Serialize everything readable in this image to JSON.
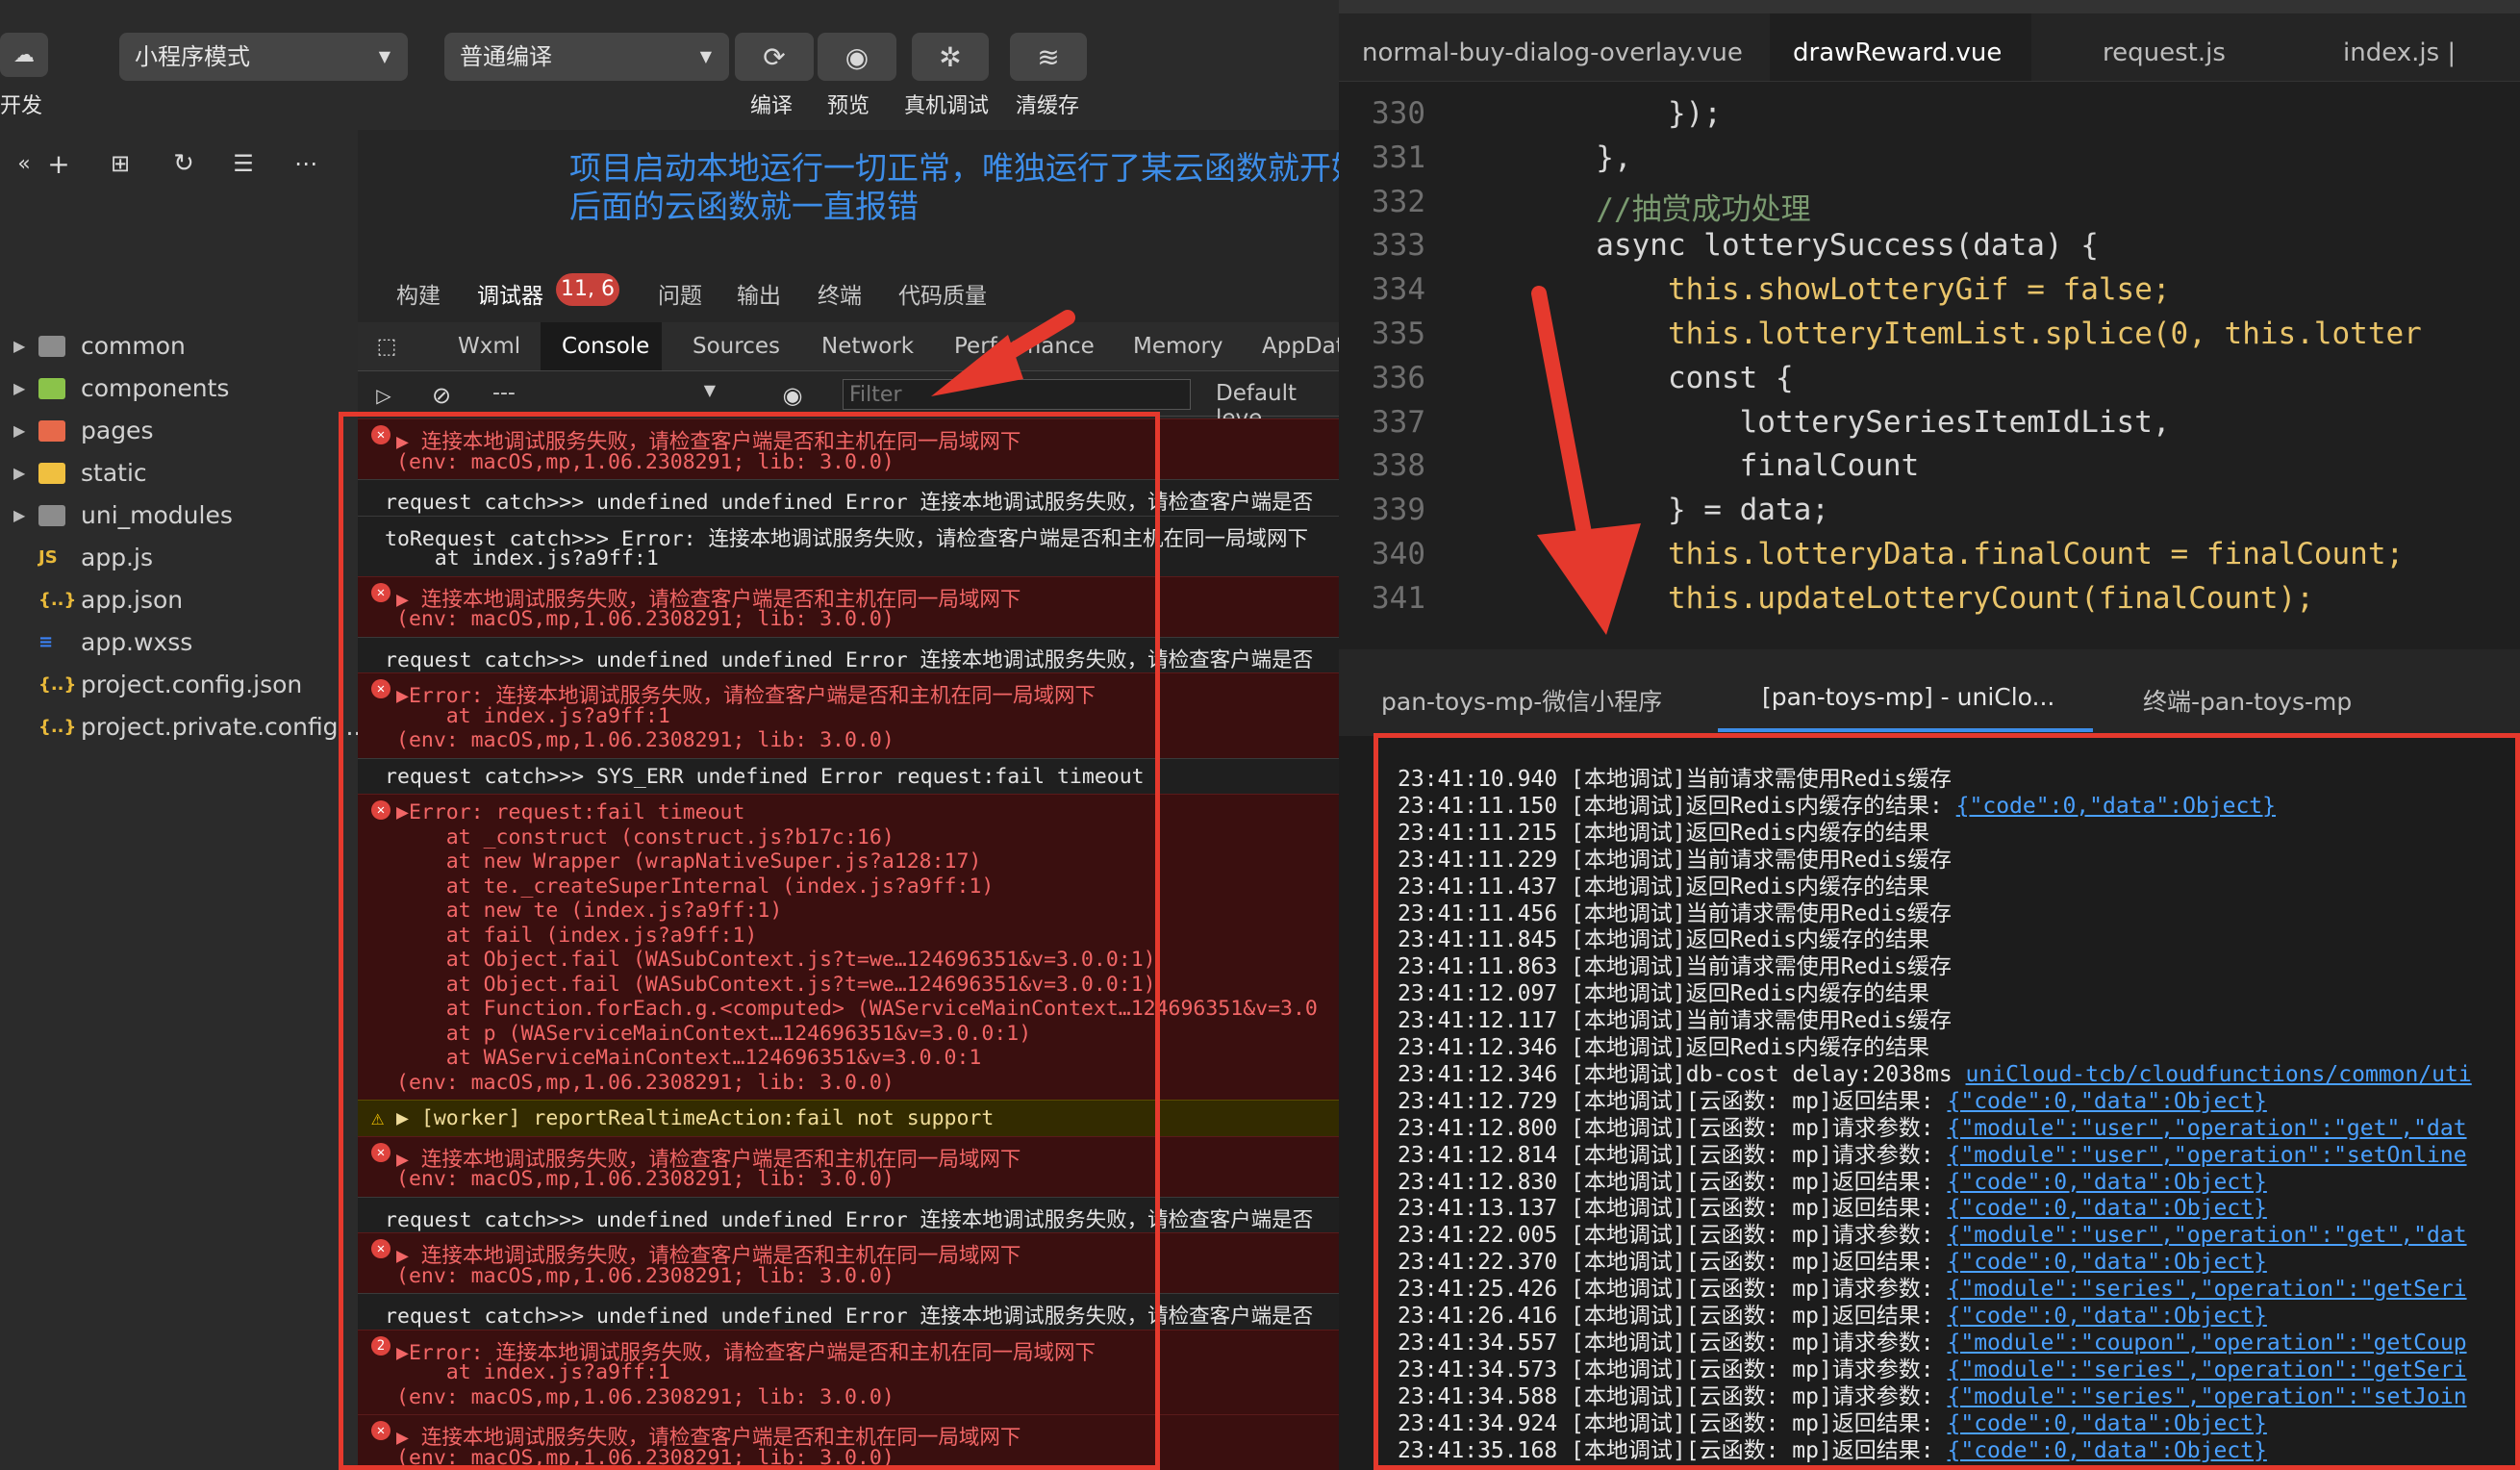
{
  "toolbar": {
    "left_label": "开发",
    "mode_select": "小程序模式",
    "compile_select": "普通编译",
    "compile_label": "编译",
    "preview_label": "预览",
    "debug_label": "真机调试",
    "clear_label": "清缓存"
  },
  "file_tree": [
    {
      "name": "common",
      "type": "folder",
      "color": "#8c8c8c"
    },
    {
      "name": "components",
      "type": "folder",
      "color": "#8bc34a"
    },
    {
      "name": "pages",
      "type": "folder",
      "color": "#e7694a"
    },
    {
      "name": "static",
      "type": "folder",
      "color": "#f0c040"
    },
    {
      "name": "uni_modules",
      "type": "folder",
      "color": "#8c8c8c"
    },
    {
      "name": "app.js",
      "type": "file",
      "badge": "JS",
      "color": "#e8b93a"
    },
    {
      "name": "app.json",
      "type": "file",
      "badge": "{..}",
      "color": "#e8b93a"
    },
    {
      "name": "app.wxss",
      "type": "file",
      "badge": "≡",
      "color": "#3b82f6"
    },
    {
      "name": "project.config.json",
      "type": "file",
      "badge": "{..}",
      "color": "#e8b93a"
    },
    {
      "name": "project.private.config...",
      "type": "file",
      "badge": "{..}",
      "color": "#e8b93a"
    }
  ],
  "annotation": {
    "line1": "项目启动本地运行一切正常，唯独运行了某云函数就开始报错了，",
    "line2": "后面的云函数就一直报错"
  },
  "devtools": {
    "top_tabs": [
      "构建",
      "调试器",
      "问题",
      "输出",
      "终端",
      "代码质量"
    ],
    "badge": "11, 6",
    "panel_tabs": [
      "Wxml",
      "Console",
      "Sources",
      "Network",
      "Performance",
      "Memory",
      "AppData"
    ],
    "context_select": "---",
    "filter_placeholder": "Filter",
    "levels": "Default leve"
  },
  "console": [
    {
      "kind": "err",
      "lines": [
        "▶ 连接本地调试服务失败，请检查客户端是否和主机在同一局域网下",
        "(env: macOS,mp,1.06.2308291; lib: 3.0.0)"
      ]
    },
    {
      "kind": "plain",
      "lines": [
        "request catch>>> undefined undefined Error 连接本地调试服务失败，请检查客户端是否"
      ]
    },
    {
      "kind": "plain",
      "lines": [
        "toRequest catch>>> Error: 连接本地调试服务失败，请检查客户端是否和主机在同一局域网下",
        "    at index.js?a9ff:1"
      ]
    },
    {
      "kind": "err",
      "lines": [
        "▶ 连接本地调试服务失败，请检查客户端是否和主机在同一局域网下",
        "(env: macOS,mp,1.06.2308291; lib: 3.0.0)"
      ]
    },
    {
      "kind": "plain",
      "lines": [
        "request catch>>> undefined undefined Error 连接本地调试服务失败，请检查客户端是否"
      ]
    },
    {
      "kind": "err",
      "lines": [
        "▶Error: 连接本地调试服务失败，请检查客户端是否和主机在同一局域网下",
        "    at index.js?a9ff:1",
        "(env: macOS,mp,1.06.2308291; lib: 3.0.0)"
      ]
    },
    {
      "kind": "plain",
      "lines": [
        "request catch>>> SYS_ERR undefined Error request:fail timeout"
      ]
    },
    {
      "kind": "err",
      "lines": [
        "▶Error: request:fail timeout",
        "    at _construct (construct.js?b17c:16)",
        "    at new Wrapper (wrapNativeSuper.js?a128:17)",
        "    at te._createSuperInternal (index.js?a9ff:1)",
        "    at new te (index.js?a9ff:1)",
        "    at fail (index.js?a9ff:1)",
        "    at Object.fail (WASubContext.js?t=we…124696351&v=3.0.0:1)",
        "    at Object.fail (WASubContext.js?t=we…124696351&v=3.0.0:1)",
        "    at Function.forEach.g.<computed> (WAServiceMainContext…124696351&v=3.0",
        "    at p (WAServiceMainContext…124696351&v=3.0.0:1)",
        "    at WAServiceMainContext…124696351&v=3.0.0:1",
        "(env: macOS,mp,1.06.2308291; lib: 3.0.0)"
      ]
    },
    {
      "kind": "warn",
      "lines": [
        "▶ [worker] reportRealtimeAction:fail not support"
      ]
    },
    {
      "kind": "err",
      "lines": [
        "▶ 连接本地调试服务失败，请检查客户端是否和主机在同一局域网下",
        "(env: macOS,mp,1.06.2308291; lib: 3.0.0)"
      ]
    },
    {
      "kind": "plain",
      "lines": [
        "request catch>>> undefined undefined Error 连接本地调试服务失败，请检查客户端是否"
      ]
    },
    {
      "kind": "err",
      "lines": [
        "▶ 连接本地调试服务失败，请检查客户端是否和主机在同一局域网下",
        "(env: macOS,mp,1.06.2308291; lib: 3.0.0)"
      ]
    },
    {
      "kind": "plain",
      "lines": [
        "request catch>>> undefined undefined Error 连接本地调试服务失败，请检查客户端是否"
      ]
    },
    {
      "kind": "err2",
      "count": "2",
      "lines": [
        "▶Error: 连接本地调试服务失败，请检查客户端是否和主机在同一局域网下",
        "    at index.js?a9ff:1",
        "(env: macOS,mp,1.06.2308291; lib: 3.0.0)"
      ]
    },
    {
      "kind": "err",
      "lines": [
        "▶ 连接本地调试服务失败，请检查客户端是否和主机在同一局域网下",
        "(env: macOS,mp,1.06.2308291; lib: 3.0.0)"
      ]
    }
  ],
  "editor": {
    "tabs": [
      "normal-buy-dialog-overlay.vue",
      "drawReward.vue",
      "request.js",
      "index.js | const"
    ],
    "active_tab": 1,
    "lines": [
      {
        "n": "330",
        "code": "            });"
      },
      {
        "n": "331",
        "code": "        },"
      },
      {
        "n": "332",
        "code": "        //抽赏成功处理"
      },
      {
        "n": "333",
        "code": "        async lotterySuccess(data) {"
      },
      {
        "n": "334",
        "code": "            this.showLotteryGif = false;"
      },
      {
        "n": "335",
        "code": "            this.lotteryItemList.splice(0, this.lotter"
      },
      {
        "n": "336",
        "code": "            const {"
      },
      {
        "n": "337",
        "code": "                lotterySeriesItemIdList,"
      },
      {
        "n": "338",
        "code": "                finalCount"
      },
      {
        "n": "339",
        "code": "            } = data;"
      },
      {
        "n": "340",
        "code": "            this.lotteryData.finalCount = finalCount;"
      },
      {
        "n": "341",
        "code": "            this.updateLotteryCount(finalCount);"
      }
    ]
  },
  "terminal": {
    "tabs": [
      "pan-toys-mp-微信小程序",
      "[pan-toys-mp] - uniClo...",
      "终端-pan-toys-mp"
    ],
    "lines": [
      {
        "t": "23:41:10.940",
        "msg": "[本地调试]当前请求需使用Redis缓存",
        "link": ""
      },
      {
        "t": "23:41:11.150",
        "msg": "[本地调试]返回Redis内缓存的结果:",
        "link": "{\"code\":0,\"data\":Object}"
      },
      {
        "t": "23:41:11.215",
        "msg": "[本地调试]返回Redis内缓存的结果",
        "link": ""
      },
      {
        "t": "23:41:11.229",
        "msg": "[本地调试]当前请求需使用Redis缓存",
        "link": ""
      },
      {
        "t": "23:41:11.437",
        "msg": "[本地调试]返回Redis内缓存的结果",
        "link": ""
      },
      {
        "t": "23:41:11.456",
        "msg": "[本地调试]当前请求需使用Redis缓存",
        "link": ""
      },
      {
        "t": "23:41:11.845",
        "msg": "[本地调试]返回Redis内缓存的结果",
        "link": ""
      },
      {
        "t": "23:41:11.863",
        "msg": "[本地调试]当前请求需使用Redis缓存",
        "link": ""
      },
      {
        "t": "23:41:12.097",
        "msg": "[本地调试]返回Redis内缓存的结果",
        "link": ""
      },
      {
        "t": "23:41:12.117",
        "msg": "[本地调试]当前请求需使用Redis缓存",
        "link": ""
      },
      {
        "t": "23:41:12.346",
        "msg": "[本地调试]返回Redis内缓存的结果",
        "link": ""
      },
      {
        "t": "23:41:12.346",
        "msg": "[本地调试]db-cost delay:2038ms",
        "link": "uniCloud-tcb/cloudfunctions/common/uti"
      },
      {
        "t": "23:41:12.729",
        "msg": "[本地调试][云函数: mp]返回结果:",
        "link": "{\"code\":0,\"data\":Object}"
      },
      {
        "t": "23:41:12.800",
        "msg": "[本地调试][云函数: mp]请求参数:",
        "link": "{\"module\":\"user\",\"operation\":\"get\",\"dat"
      },
      {
        "t": "23:41:12.814",
        "msg": "[本地调试][云函数: mp]请求参数:",
        "link": "{\"module\":\"user\",\"operation\":\"setOnline"
      },
      {
        "t": "23:41:12.830",
        "msg": "[本地调试][云函数: mp]返回结果:",
        "link": "{\"code\":0,\"data\":Object}"
      },
      {
        "t": "23:41:13.137",
        "msg": "[本地调试][云函数: mp]返回结果:",
        "link": "{\"code\":0,\"data\":Object}"
      },
      {
        "t": "23:41:22.005",
        "msg": "[本地调试][云函数: mp]请求参数:",
        "link": "{\"module\":\"user\",\"operation\":\"get\",\"dat"
      },
      {
        "t": "23:41:22.370",
        "msg": "[本地调试][云函数: mp]返回结果:",
        "link": "{\"code\":0,\"data\":Object}"
      },
      {
        "t": "23:41:25.426",
        "msg": "[本地调试][云函数: mp]请求参数:",
        "link": "{\"module\":\"series\",\"operation\":\"getSeri"
      },
      {
        "t": "23:41:26.416",
        "msg": "[本地调试][云函数: mp]返回结果:",
        "link": "{\"code\":0,\"data\":Object}"
      },
      {
        "t": "23:41:34.557",
        "msg": "[本地调试][云函数: mp]请求参数:",
        "link": "{\"module\":\"coupon\",\"operation\":\"getCoup"
      },
      {
        "t": "23:41:34.573",
        "msg": "[本地调试][云函数: mp]请求参数:",
        "link": "{\"module\":\"series\",\"operation\":\"getSeri"
      },
      {
        "t": "23:41:34.588",
        "msg": "[本地调试][云函数: mp]请求参数:",
        "link": "{\"module\":\"series\",\"operation\":\"setJoin"
      },
      {
        "t": "23:41:34.924",
        "msg": "[本地调试][云函数: mp]返回结果:",
        "link": "{\"code\":0,\"data\":Object}"
      },
      {
        "t": "23:41:35.168",
        "msg": "[本地调试][云函数: mp]返回结果:",
        "link": "{\"code\":0,\"data\":Object}"
      }
    ]
  },
  "colors": {
    "accent_blue": "#3d8de8",
    "annotation_red": "#e5392d",
    "error_red": "#f26666"
  }
}
